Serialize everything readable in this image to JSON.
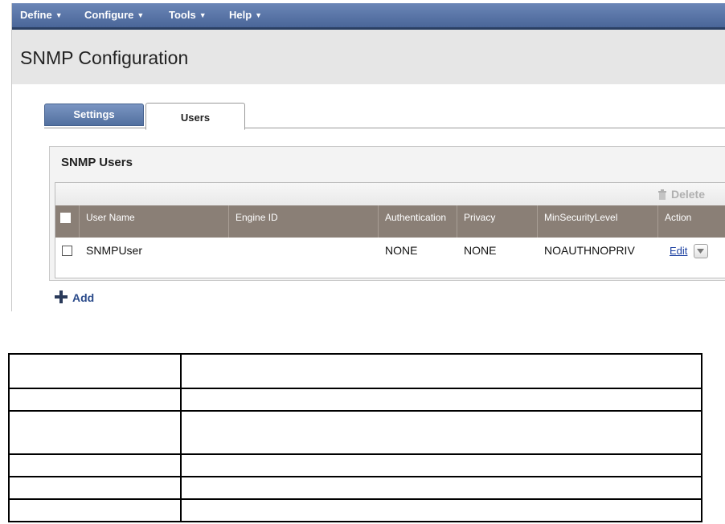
{
  "menubar": {
    "items": [
      {
        "label": "Define"
      },
      {
        "label": "Configure"
      },
      {
        "label": "Tools"
      },
      {
        "label": "Help"
      }
    ]
  },
  "page": {
    "title": "SNMP Configuration"
  },
  "tabs": [
    {
      "label": "Settings",
      "selected": false
    },
    {
      "label": "Users",
      "selected": true
    }
  ],
  "panel": {
    "title": "SNMP Users",
    "toolbar": {
      "delete_label": "Delete"
    },
    "columns": [
      "User Name",
      "Engine ID",
      "Authentication",
      "Privacy",
      "MinSecurityLevel",
      "Action"
    ],
    "rows": [
      {
        "user_name": "SNMPUser",
        "engine_id": "",
        "authentication": "NONE",
        "privacy": "NONE",
        "min_security_level": "NOAUTHNOPRIV",
        "action_label": "Edit"
      }
    ],
    "add_label": "Add"
  },
  "colors": {
    "menubar": "#4a6699",
    "header_row": "#8a7f76",
    "link": "#1a3fa0"
  }
}
